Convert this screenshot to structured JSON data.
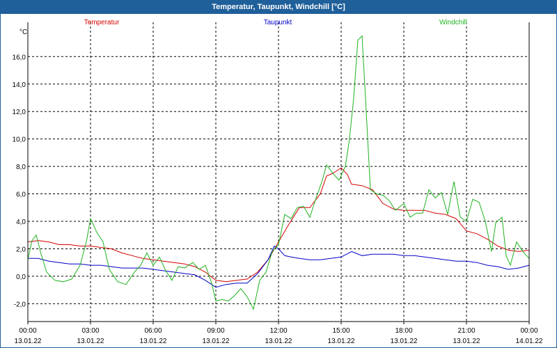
{
  "window": {
    "title": "Temperatur, Taupunkt, Windchill [°C]"
  },
  "colors": {
    "titlebar": "#1f5f9a",
    "temperatur": "#d40000",
    "taupunkt": "#0000c8",
    "windchill": "#1fb21f"
  },
  "chart_data": {
    "type": "line",
    "title": "Temperatur, Taupunkt, Windchill [°C]",
    "ylabel": "°C",
    "xlabel": "",
    "ylim": [
      -3.3,
      18.5
    ],
    "xlim": [
      0,
      24
    ],
    "yticks": [
      -2,
      0,
      2,
      4,
      6,
      8,
      10,
      12,
      14,
      16
    ],
    "yticklabels": [
      "-2,0",
      "0,0",
      "2,0",
      "4,0",
      "6,0",
      "8,0",
      "10,0",
      "12,0",
      "14,0",
      "16,0"
    ],
    "xticks": [
      {
        "x": 0,
        "time": "00:00",
        "date": "13.01.22"
      },
      {
        "x": 3,
        "time": "03:00",
        "date": "13.01.22"
      },
      {
        "x": 6,
        "time": "06:00",
        "date": "13.01.22"
      },
      {
        "x": 9,
        "time": "09:00",
        "date": "13.01.22"
      },
      {
        "x": 12,
        "time": "12:00",
        "date": "13.01.22"
      },
      {
        "x": 15,
        "time": "15:00",
        "date": "13.01.22"
      },
      {
        "x": 18,
        "time": "18:00",
        "date": "13.01.22"
      },
      {
        "x": 21,
        "time": "21:00",
        "date": "13.01.22"
      },
      {
        "x": 24,
        "time": "00:00",
        "date": "14.01.22"
      }
    ],
    "grid": true,
    "legend_position": "top",
    "series": [
      {
        "name": "Temperatur",
        "points": [
          [
            0,
            2.5
          ],
          [
            0.5,
            2.6
          ],
          [
            1,
            2.5
          ],
          [
            1.5,
            2.3
          ],
          [
            2,
            2.3
          ],
          [
            2.5,
            2.2
          ],
          [
            3,
            2.2
          ],
          [
            3.5,
            2.1
          ],
          [
            4,
            2.0
          ],
          [
            4.5,
            1.7
          ],
          [
            5,
            1.5
          ],
          [
            5.5,
            1.3
          ],
          [
            6,
            1.2
          ],
          [
            6.5,
            1.1
          ],
          [
            7,
            1.0
          ],
          [
            7.5,
            0.9
          ],
          [
            8,
            0.7
          ],
          [
            8.5,
            0.3
          ],
          [
            9,
            -0.3
          ],
          [
            9.5,
            -0.4
          ],
          [
            10,
            -0.3
          ],
          [
            10.5,
            -0.2
          ],
          [
            11,
            0.3
          ],
          [
            11.5,
            1.2
          ],
          [
            12,
            2.5
          ],
          [
            12.5,
            3.8
          ],
          [
            13,
            5.0
          ],
          [
            13.5,
            5.0
          ],
          [
            14,
            6.0
          ],
          [
            14.3,
            7.3
          ],
          [
            14.6,
            7.5
          ],
          [
            15,
            7.9
          ],
          [
            15.3,
            7.4
          ],
          [
            15.5,
            6.7
          ],
          [
            16,
            6.6
          ],
          [
            16.5,
            6.3
          ],
          [
            17,
            5.3
          ],
          [
            17.5,
            4.9
          ],
          [
            18,
            4.8
          ],
          [
            18.5,
            4.8
          ],
          [
            19,
            4.8
          ],
          [
            19.5,
            4.6
          ],
          [
            20,
            4.5
          ],
          [
            20.5,
            4.2
          ],
          [
            21,
            3.3
          ],
          [
            21.5,
            3.1
          ],
          [
            22,
            2.7
          ],
          [
            22.5,
            2.2
          ],
          [
            23,
            1.9
          ],
          [
            23.5,
            1.8
          ],
          [
            24,
            1.9
          ]
        ]
      },
      {
        "name": "Taupunkt",
        "points": [
          [
            0,
            1.3
          ],
          [
            0.5,
            1.3
          ],
          [
            1,
            1.1
          ],
          [
            1.5,
            1.0
          ],
          [
            2,
            0.9
          ],
          [
            2.5,
            0.9
          ],
          [
            3,
            0.8
          ],
          [
            3.5,
            0.8
          ],
          [
            4,
            0.7
          ],
          [
            4.5,
            0.6
          ],
          [
            5,
            0.6
          ],
          [
            5.5,
            0.6
          ],
          [
            6,
            0.5
          ],
          [
            6.5,
            0.4
          ],
          [
            7,
            0.3
          ],
          [
            7.5,
            0.2
          ],
          [
            8,
            0.1
          ],
          [
            8.5,
            -0.3
          ],
          [
            9,
            -0.8
          ],
          [
            9.5,
            -0.6
          ],
          [
            10,
            -0.5
          ],
          [
            10.5,
            -0.5
          ],
          [
            11,
            0.2
          ],
          [
            11.5,
            1.2
          ],
          [
            11.8,
            2.2
          ],
          [
            12,
            2.0
          ],
          [
            12.3,
            1.5
          ],
          [
            12.6,
            1.4
          ],
          [
            13,
            1.3
          ],
          [
            13.5,
            1.2
          ],
          [
            14,
            1.2
          ],
          [
            14.5,
            1.3
          ],
          [
            15,
            1.4
          ],
          [
            15.5,
            1.8
          ],
          [
            16,
            1.5
          ],
          [
            16.5,
            1.6
          ],
          [
            17,
            1.6
          ],
          [
            17.5,
            1.6
          ],
          [
            18,
            1.5
          ],
          [
            18.5,
            1.5
          ],
          [
            19,
            1.4
          ],
          [
            19.5,
            1.3
          ],
          [
            20,
            1.2
          ],
          [
            20.5,
            1.1
          ],
          [
            21,
            1.1
          ],
          [
            21.5,
            1.0
          ],
          [
            22,
            0.8
          ],
          [
            22.5,
            0.7
          ],
          [
            23,
            0.5
          ],
          [
            23.5,
            0.6
          ],
          [
            24,
            0.8
          ]
        ]
      },
      {
        "name": "Windchill",
        "points": [
          [
            0,
            1.2
          ],
          [
            0.2,
            2.6
          ],
          [
            0.4,
            3.0
          ],
          [
            0.6,
            1.8
          ],
          [
            0.9,
            0.3
          ],
          [
            1.3,
            -0.3
          ],
          [
            1.7,
            -0.4
          ],
          [
            2.1,
            -0.2
          ],
          [
            2.5,
            0.8
          ],
          [
            2.8,
            2.5
          ],
          [
            3.0,
            4.2
          ],
          [
            3.3,
            3.2
          ],
          [
            3.6,
            2.5
          ],
          [
            3.9,
            0.5
          ],
          [
            4.3,
            -0.4
          ],
          [
            4.7,
            -0.6
          ],
          [
            5.1,
            0.3
          ],
          [
            5.4,
            0.8
          ],
          [
            5.7,
            1.7
          ],
          [
            6.0,
            0.8
          ],
          [
            6.3,
            1.4
          ],
          [
            6.6,
            0.4
          ],
          [
            6.9,
            -0.3
          ],
          [
            7.2,
            0.7
          ],
          [
            7.5,
            0.6
          ],
          [
            7.9,
            1.0
          ],
          [
            8.2,
            0.5
          ],
          [
            8.5,
            0.8
          ],
          [
            8.8,
            -0.5
          ],
          [
            9.0,
            -1.8
          ],
          [
            9.3,
            -1.7
          ],
          [
            9.6,
            -1.8
          ],
          [
            9.9,
            -1.4
          ],
          [
            10.2,
            -0.9
          ],
          [
            10.5,
            -1.5
          ],
          [
            10.8,
            -2.4
          ],
          [
            11.1,
            -0.3
          ],
          [
            11.4,
            0.3
          ],
          [
            11.7,
            1.8
          ],
          [
            12.0,
            2.3
          ],
          [
            12.3,
            4.5
          ],
          [
            12.6,
            4.2
          ],
          [
            12.9,
            5.0
          ],
          [
            13.2,
            5.1
          ],
          [
            13.5,
            4.3
          ],
          [
            13.8,
            5.7
          ],
          [
            14.1,
            7.0
          ],
          [
            14.3,
            8.1
          ],
          [
            14.6,
            7.5
          ],
          [
            14.9,
            7.0
          ],
          [
            15.2,
            8.0
          ],
          [
            15.4,
            10.0
          ],
          [
            15.6,
            13.0
          ],
          [
            15.8,
            17.2
          ],
          [
            16.0,
            17.5
          ],
          [
            16.2,
            12.0
          ],
          [
            16.4,
            6.3
          ],
          [
            16.7,
            6.0
          ],
          [
            17.0,
            5.9
          ],
          [
            17.3,
            5.5
          ],
          [
            17.6,
            4.8
          ],
          [
            18.0,
            5.3
          ],
          [
            18.3,
            4.3
          ],
          [
            18.6,
            4.6
          ],
          [
            18.9,
            4.6
          ],
          [
            19.2,
            6.3
          ],
          [
            19.5,
            5.7
          ],
          [
            19.8,
            6.1
          ],
          [
            20.1,
            4.5
          ],
          [
            20.4,
            6.9
          ],
          [
            20.7,
            4.3
          ],
          [
            21.0,
            4.0
          ],
          [
            21.3,
            5.6
          ],
          [
            21.6,
            5.4
          ],
          [
            21.9,
            4.0
          ],
          [
            22.2,
            1.8
          ],
          [
            22.4,
            3.9
          ],
          [
            22.7,
            4.3
          ],
          [
            22.9,
            1.5
          ],
          [
            23.1,
            0.8
          ],
          [
            23.4,
            2.5
          ],
          [
            23.7,
            1.8
          ],
          [
            24.0,
            1.3
          ]
        ]
      }
    ]
  }
}
